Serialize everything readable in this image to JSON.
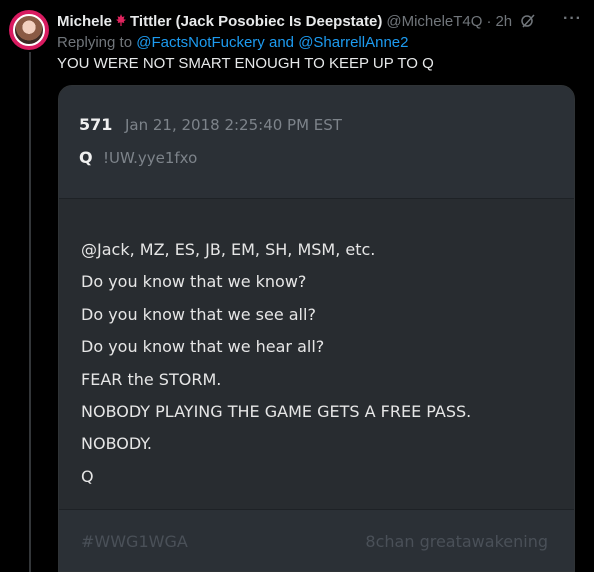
{
  "tweet": {
    "author_first": "Michele",
    "flag_icon": "canada-flag-icon",
    "author_rest": "Tittler (Jack Posobiec Is Deepstate)",
    "handle": "@MicheleT4Q",
    "separator": "·",
    "time": "2h",
    "replying_prefix": "Replying to",
    "replying_user1": "@FactsNotFuckery",
    "replying_and": "and",
    "replying_user2": "@SharrellAnne2",
    "text": "YOU WERE NOT SMART ENOUGH TO KEEP UP TO Q",
    "more_label": "···"
  },
  "card": {
    "post_number": "571",
    "date": "Jan 21, 2018 2:25:40 PM EST",
    "author_label": "Q",
    "tripcode": "!UW.yye1fxo",
    "lines": [
      "@Jack, MZ, ES, JB, EM, SH, MSM, etc.",
      "Do you know that we know?",
      "Do you know that we see all?",
      "Do you know that we hear all?",
      "FEAR the STORM.",
      "NOBODY PLAYING THE GAME GETS A FREE PASS.",
      "NOBODY.",
      "Q"
    ],
    "hashtag": "#WWG1WGA",
    "board": "8chan greatawakening"
  },
  "colors": {
    "background": "#000000",
    "link": "#1d9bf0",
    "muted": "#71767b",
    "card_bg": "#282c30",
    "avatar_ring": "#d81b60"
  }
}
